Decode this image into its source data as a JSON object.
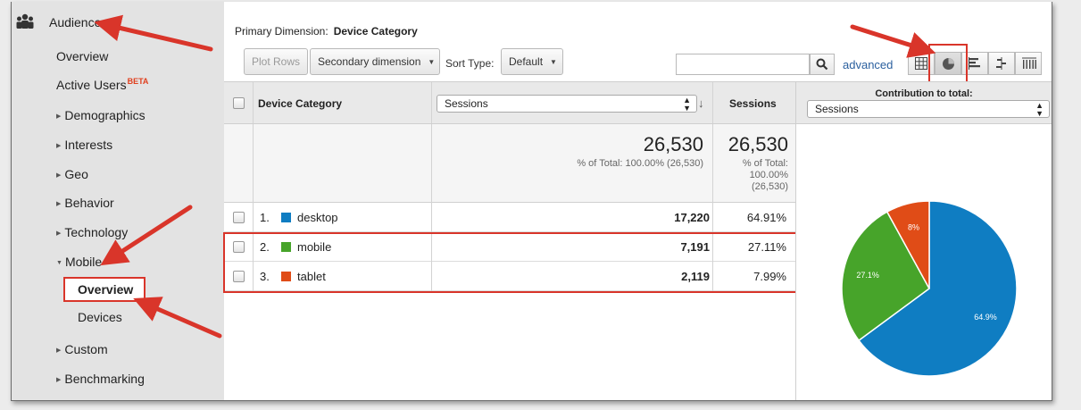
{
  "sidebar": {
    "section_title": "Audience",
    "items": [
      {
        "label": "Overview"
      },
      {
        "label": "Active Users",
        "badge": "BETA"
      },
      {
        "label": "Demographics"
      },
      {
        "label": "Interests"
      },
      {
        "label": "Geo"
      },
      {
        "label": "Behavior"
      },
      {
        "label": "Technology"
      },
      {
        "label": "Mobile"
      },
      {
        "label": "Overview"
      },
      {
        "label": "Devices"
      },
      {
        "label": "Custom"
      },
      {
        "label": "Benchmarking"
      }
    ]
  },
  "header": {
    "primary_dimension_label": "Primary Dimension:",
    "primary_dimension_value": "Device Category"
  },
  "toolbar": {
    "plot_rows": "Plot Rows",
    "secondary_dimension": "Secondary dimension",
    "sort_type_label": "Sort Type:",
    "sort_type_value": "Default",
    "search_placeholder": "",
    "advanced": "advanced"
  },
  "view_icons": [
    "table-view-icon",
    "pie-view-icon",
    "performance-view-icon",
    "comparison-view-icon",
    "pivot-view-icon"
  ],
  "table": {
    "col_dimension": "Device Category",
    "col_metric_select": "Sessions",
    "col_sessions": "Sessions",
    "totals": {
      "value": "26,530",
      "pct_text": "% of Total: 100.00% (26,530)",
      "value2": "26,530",
      "pct_line1": "% of Total:",
      "pct_line2": "100.00%",
      "pct_line3": "(26,530)"
    },
    "rows": [
      {
        "index": "1.",
        "label": "desktop",
        "value": "17,220",
        "pct": "64.91%",
        "color": "#0f7dc2"
      },
      {
        "index": "2.",
        "label": "mobile",
        "value": "7,191",
        "pct": "27.11%",
        "color": "#47a42a"
      },
      {
        "index": "3.",
        "label": "tablet",
        "value": "2,119",
        "pct": "7.99%",
        "color": "#e04c17"
      }
    ]
  },
  "contribution": {
    "title": "Contribution to total:",
    "metric": "Sessions"
  },
  "chart_data": {
    "type": "pie",
    "categories": [
      "desktop",
      "mobile",
      "tablet"
    ],
    "values": [
      64.9,
      27.1,
      8
    ],
    "labels": [
      "64.9%",
      "27.1%",
      "8%"
    ],
    "colors": [
      "#0f7dc2",
      "#47a42a",
      "#e04c17"
    ]
  },
  "colors": {
    "annotation_red": "#d9352a",
    "link_blue": "#2a5f9e"
  }
}
